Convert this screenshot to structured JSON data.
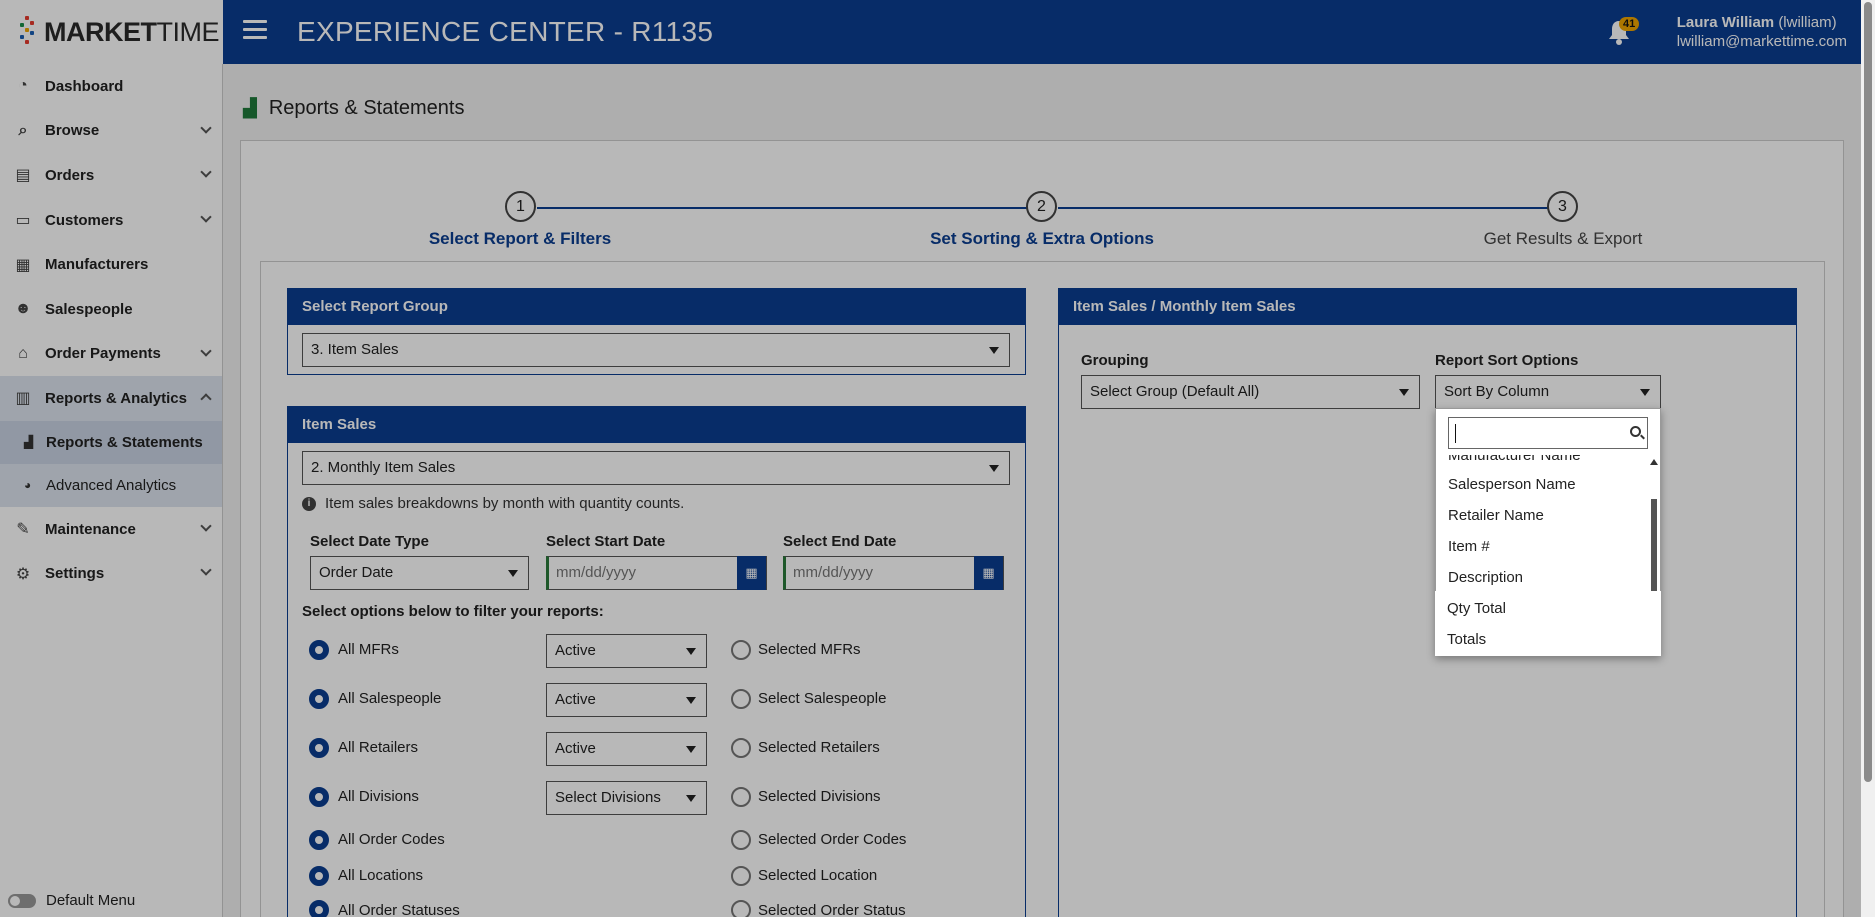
{
  "header": {
    "logo_text_bold": "MARKET",
    "logo_text_light": "TIME",
    "app_title": "EXPERIENCE CENTER - R1135",
    "notification_count": "41",
    "user_name": "Laura William",
    "user_handle": "(lwilliam)",
    "user_email": "lwilliam@markettime.com"
  },
  "sidebar": {
    "items": [
      {
        "label": "Dashboard",
        "icon": "dashboard-icon"
      },
      {
        "label": "Browse",
        "icon": "search-icon"
      },
      {
        "label": "Orders",
        "icon": "document-icon"
      },
      {
        "label": "Customers",
        "icon": "id-card-icon"
      },
      {
        "label": "Manufacturers",
        "icon": "building-icon"
      },
      {
        "label": "Salespeople",
        "icon": "users-icon"
      },
      {
        "label": "Order Payments",
        "icon": "bank-icon"
      },
      {
        "label": "Reports & Analytics",
        "icon": "chart-icon"
      },
      {
        "label": "Reports & Statements",
        "icon": "area-chart-icon"
      },
      {
        "label": "Advanced Analytics",
        "icon": "pie-chart-icon"
      },
      {
        "label": "Maintenance",
        "icon": "wrench-icon"
      },
      {
        "label": "Settings",
        "icon": "gears-icon"
      }
    ],
    "default_menu_label": "Default Menu"
  },
  "page": {
    "title": "Reports & Statements"
  },
  "steps": [
    {
      "number": "1",
      "label": "Select Report & Filters"
    },
    {
      "number": "2",
      "label": "Set Sorting & Extra Options"
    },
    {
      "number": "3",
      "label": "Get Results & Export"
    }
  ],
  "report_group": {
    "heading": "Select Report Group",
    "value": "3. Item Sales"
  },
  "item_sales": {
    "heading": "Item Sales",
    "value": "2. Monthly Item Sales",
    "description": "Item sales breakdowns by month with quantity counts.",
    "date_type_label": "Select Date Type",
    "date_type_value": "Order Date",
    "start_date_label": "Select Start Date",
    "start_date_placeholder": "mm/dd/yyyy",
    "end_date_label": "Select End Date",
    "end_date_placeholder": "mm/dd/yyyy",
    "filter_prompt": "Select options below to filter your reports:",
    "filters": [
      {
        "all_label": "All MFRs",
        "status": "Active",
        "selected_label": "Selected MFRs"
      },
      {
        "all_label": "All Salespeople",
        "status": "Active",
        "selected_label": "Select Salespeople"
      },
      {
        "all_label": "All Retailers",
        "status": "Active",
        "selected_label": "Selected Retailers"
      },
      {
        "all_label": "All Divisions",
        "status": "Select Divisions",
        "selected_label": "Selected Divisions"
      },
      {
        "all_label": "All Order Codes",
        "status": "",
        "selected_label": "Selected Order Codes"
      },
      {
        "all_label": "All Locations",
        "status": "",
        "selected_label": "Selected Location"
      },
      {
        "all_label": "All Order Statuses",
        "status": "",
        "selected_label": "Selected Order Status"
      }
    ]
  },
  "sorting": {
    "heading": "Item Sales / Monthly Item Sales",
    "grouping_label": "Grouping",
    "grouping_value": "Select Group (Default All)",
    "sort_label": "Report Sort Options",
    "sort_value": "Sort By Column",
    "search_value": "",
    "options": [
      "Manufacturer Name",
      "Salesperson Name",
      "Retailer Name",
      "Item #",
      "Description",
      "Qty Total",
      "Totals"
    ]
  }
}
